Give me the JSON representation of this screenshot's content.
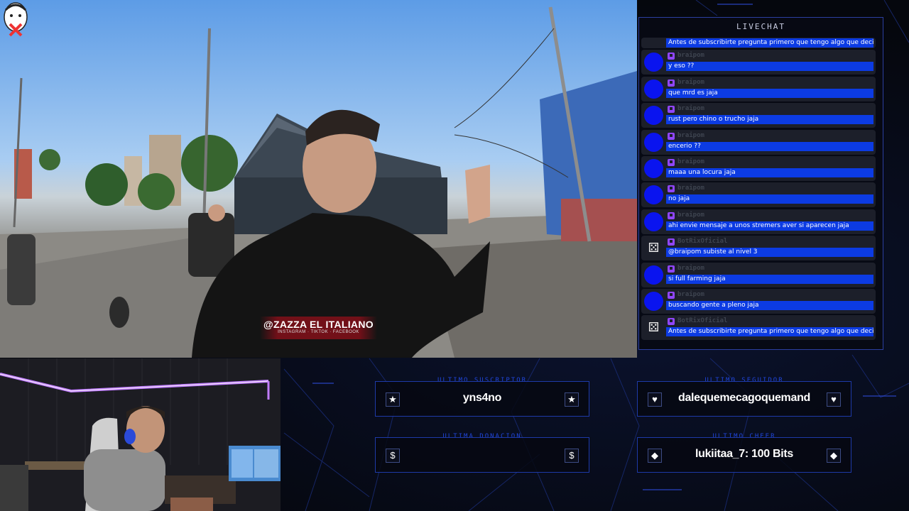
{
  "overlay": {
    "name_tag": {
      "main": "@ZAZZA EL ITALIANO",
      "sub": "INSTAGRAM · TIKTOK · FACEBOOK"
    }
  },
  "livechat": {
    "title": "LIVECHAT",
    "messages": [
      {
        "user": "",
        "text": "Antes de subscribirte pregunta primero que tengo algo que decirte ☺",
        "bot": true,
        "first": true
      },
      {
        "user": "braipom",
        "text": "y eso ??",
        "bot": false
      },
      {
        "user": "braipom",
        "text": "que mrd es jaja",
        "bot": false
      },
      {
        "user": "braipom",
        "text": "rust pero chino o trucho jaja",
        "bot": false
      },
      {
        "user": "braipom",
        "text": "encerio ??",
        "bot": false
      },
      {
        "user": "braipom",
        "text": "maaa una locura jaja",
        "bot": false
      },
      {
        "user": "braipom",
        "text": "no jaja",
        "bot": false
      },
      {
        "user": "braipom",
        "text": "ahi envie mensaje a unos stremers aver si aparecen jaja",
        "bot": false
      },
      {
        "user": "BotRixOficial",
        "text": "@braipom subiste al nivel 3",
        "bot": true
      },
      {
        "user": "braipom",
        "text": "si full farming jaja",
        "bot": false
      },
      {
        "user": "braipom",
        "text": "buscando gente a pleno jaja",
        "bot": false
      },
      {
        "user": "BotRixOficial",
        "text": "Antes de subscribirte pregunta primero que tengo algo que decirte ☺",
        "bot": true
      }
    ]
  },
  "stats": {
    "ultimo_suscriptor": {
      "label": "ULTIMO SUSCRIPTOR",
      "value": "yns4no",
      "icon": "★"
    },
    "ultimo_seguidor": {
      "label": "ULTIMO SEGUIDOR",
      "value": "dalequemecagoquemand",
      "icon": "♥"
    },
    "ultima_donacion": {
      "label": "ULTIMA DONACION",
      "value": "",
      "icon": "$"
    },
    "ultimo_cheer": {
      "label": "ULTIMO CHEER",
      "value": "lukiitaa_7: 100 Bits",
      "icon": "◆"
    }
  },
  "colors": {
    "accent": "#0c3be3",
    "frame": "#1e3aa8",
    "twitch": "#9146ff",
    "led": "#b06cff"
  }
}
